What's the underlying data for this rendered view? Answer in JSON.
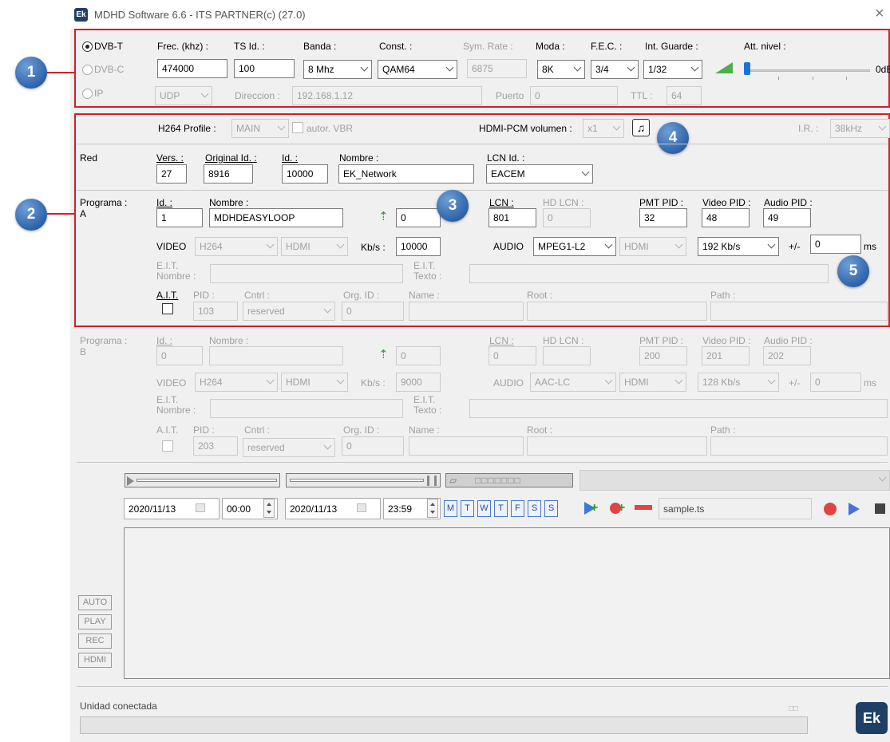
{
  "window": {
    "title": "MDHD Software 6.6 - ITS PARTNER(c) (27.0)",
    "logo": "Ek",
    "close": "×"
  },
  "callouts": [
    "1",
    "2",
    "3",
    "4",
    "5"
  ],
  "modulation": {
    "dvbt": "DVB-T",
    "dvbc": "DVB-C",
    "ip": "IP",
    "freq_label": "Frec. (khz) :",
    "freq": "474000",
    "tsid_label": "TS Id. :",
    "tsid": "100",
    "banda_label": "Banda :",
    "banda": "8 Mhz",
    "const_label": "Const. :",
    "const": "QAM64",
    "symrate_label": "Sym. Rate :",
    "symrate": "6875",
    "moda_label": "Moda :",
    "moda": "8K",
    "fec_label": "F.E.C. :",
    "fec": "3/4",
    "guard_label": "Int. Guarde :",
    "guard": "1/32",
    "att_label": "Att. nivel :",
    "att_value": "0dB",
    "udp": "UDP",
    "dir_label": "Direccion :",
    "dir": "192.168.1.12",
    "port_label": "Puerto",
    "port": "0",
    "ttl_label": "TTL :",
    "ttl": "64"
  },
  "encoder": {
    "h264_label": "H264 Profile :",
    "h264": "MAIN",
    "vbr_label": "autor. VBR",
    "pcm_label": "HDMI-PCM volumen :",
    "pcm": "x1",
    "ir_label": "I.R. :",
    "ir": "38kHz"
  },
  "network": {
    "title": "Red",
    "vers_label": "Vers. :",
    "vers": "27",
    "origid_label": "Original Id. :",
    "origid": "8916",
    "id_label": "Id. :",
    "id": "10000",
    "name_label": "Nombre :",
    "name": "EK_Network",
    "lcnid_label": "LCN Id. :",
    "lcnid": "EACEM"
  },
  "program_a": {
    "title": "Programa :",
    "letter": "A",
    "id_label": "Id. :",
    "id": "1",
    "name_label": "Nombre :",
    "name": "MDHDEASYLOOP",
    "tsid_value": "0",
    "lcn_label": "LCN :",
    "lcn": "801",
    "hdlcn_label": "HD LCN :",
    "hdlcn": "0",
    "pmt_label": "PMT PID :",
    "pmt": "32",
    "vpid_label": "Video PID :",
    "vpid": "48",
    "apid_label": "Audio PID :",
    "apid": "49",
    "video_label": "VIDEO",
    "vcodec": "H264",
    "vsrc": "HDMI",
    "kbs_label": "Kb/s :",
    "kbs": "10000",
    "audio_label": "AUDIO",
    "acodec": "MPEG1-L2",
    "asrc": "HDMI",
    "abitrate": "192 Kb/s",
    "delay_label": "+/-",
    "delay": "0",
    "ms": "ms",
    "eit_name_label1": "E.I.T.",
    "eit_name_label2": "Nombre :",
    "eit_text_label1": "E.I.T.",
    "eit_text_label2": "Texto :",
    "ait_label": "A.I.T.",
    "pid_label": "PID :",
    "pid": "103",
    "cntrl_label": "Cntrl :",
    "cntrl": "reserved",
    "orgid_label": "Org. ID :",
    "orgid": "0",
    "aname_label": "Name :",
    "root_label": "Root :",
    "path_label": "Path :"
  },
  "program_b": {
    "title": "Programa :",
    "letter": "B",
    "id_label": "Id. :",
    "id": "0",
    "name_label": "Nombre :",
    "tsid_value": "0",
    "lcn_label": "LCN :",
    "lcn": "0",
    "hdlcn_label": "HD LCN :",
    "pmt_label": "PMT PID :",
    "pmt": "200",
    "vpid_label": "Video PID :",
    "vpid": "201",
    "apid_label": "Audio PID :",
    "apid": "202",
    "video_label": "VIDEO",
    "vcodec": "H264",
    "vsrc": "HDMI",
    "kbs_label": "Kb/s :",
    "kbs": "9000",
    "audio_label": "AUDIO",
    "acodec": "AAC-LC",
    "asrc": "HDMI",
    "abitrate": "128 Kb/s",
    "delay_label": "+/-",
    "delay": "0",
    "ms": "ms",
    "eit_name_label1": "E.I.T.",
    "eit_name_label2": "Nombre :",
    "eit_text_label1": "E.I.T.",
    "eit_text_label2": "Texto :",
    "ait_label": "A.I.T.",
    "pid_label": "PID :",
    "pid": "203",
    "cntrl_label": "Cntrl :",
    "cntrl": "reserved",
    "orgid_label": "Org. ID :",
    "orgid": "0",
    "aname_label": "Name :",
    "root_label": "Root :",
    "path_label": "Path :"
  },
  "scheduler": {
    "start_date": "2020/11/13",
    "start_time": "00:00",
    "end_date": "2020/11/13",
    "end_time": "23:59",
    "days": [
      "M",
      "T",
      "W",
      "T",
      "F",
      "S",
      "S"
    ],
    "file": "sample.ts"
  },
  "side_buttons": [
    "AUTO",
    "PLAY",
    "REC",
    "HDMI"
  ],
  "status": {
    "text": "Unidad conectada",
    "logo": "Ek"
  }
}
